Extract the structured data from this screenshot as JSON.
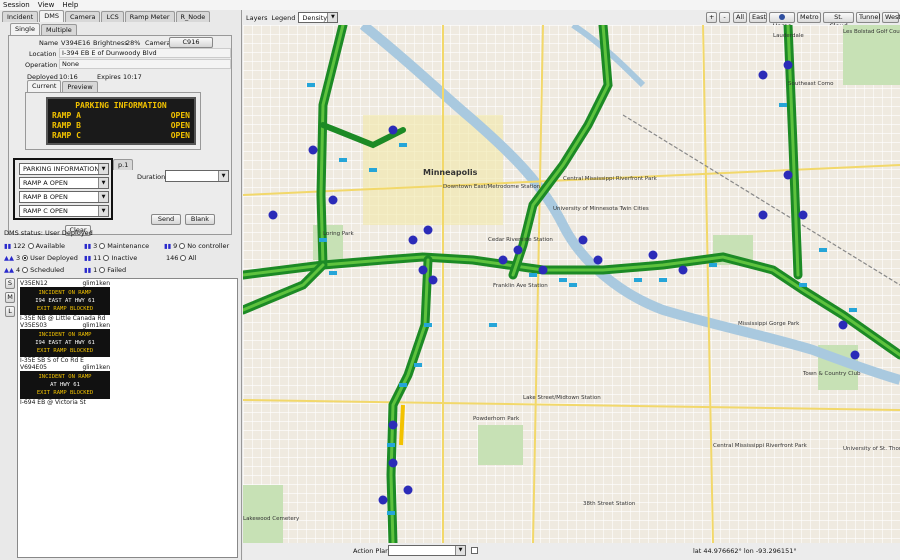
{
  "menu": [
    "Session",
    "View",
    "Help"
  ],
  "main_tabs": [
    "Incident",
    "DMS",
    "Camera",
    "LCS",
    "Ramp Meter",
    "R_Node"
  ],
  "sub_tabs": [
    "Single",
    "Multiple"
  ],
  "dms": {
    "name_label": "Name",
    "name": "V394E16",
    "brightness_label": "Brightness",
    "brightness": "28%",
    "camera_label": "Camera",
    "camera": "C916",
    "location_label": "Location",
    "location": "I-394 EB E of Dunwoody Blvd",
    "operation_label": "Operation",
    "operation": "None",
    "deployed_label": "Deployed",
    "deployed": "10:16",
    "expires_label": "Expires",
    "expires": "10:17"
  },
  "preview_tabs": [
    "Current",
    "Preview"
  ],
  "sign_lines": [
    {
      "left": "PARKING INFORMATION",
      "right": ""
    },
    {
      "left": "RAMP A",
      "right": "OPEN"
    },
    {
      "left": "RAMP B",
      "right": "OPEN"
    },
    {
      "left": "RAMP C",
      "right": "OPEN"
    }
  ],
  "compose": {
    "line1": "PARKING INFORMATION",
    "line2": "RAMP A OPEN",
    "line3": "RAMP B OPEN",
    "line4": "RAMP C OPEN",
    "page_label": "p.1",
    "duration_label": "Duration",
    "duration": "",
    "send": "Send",
    "blank": "Blank",
    "clear": "Clear"
  },
  "status": {
    "title": "DMS status: User Deployed",
    "items": [
      {
        "sym": "▮▮",
        "count": "122",
        "label": "Available",
        "selected": false
      },
      {
        "sym": "▮▮",
        "count": "3",
        "label": "Maintenance",
        "selected": false
      },
      {
        "sym": "▮▮",
        "count": "9",
        "label": "No controller",
        "selected": false
      },
      {
        "sym": "▲▲",
        "count": "3",
        "label": "User Deployed",
        "selected": true
      },
      {
        "sym": "▮▮",
        "count": "11",
        "label": "Inactive",
        "selected": false
      },
      {
        "sym": "",
        "count": "146",
        "label": "All",
        "selected": false
      },
      {
        "sym": "▲▲",
        "count": "4",
        "label": "Scheduled",
        "selected": false
      },
      {
        "sym": "▮▮",
        "count": "1",
        "label": "Failed",
        "selected": false
      }
    ]
  },
  "size_buttons": [
    "S",
    "M",
    "L"
  ],
  "cards": [
    {
      "id": "V35EN12",
      "user": "glim1ken",
      "lines": [
        "INCIDENT ON RAMP",
        "I94 EAST AT HWY 61",
        "EXIT RAMP BLOCKED"
      ],
      "location": "I-35E NB @ Little Canada Rd"
    },
    {
      "id": "V35ES03",
      "user": "glim1ken",
      "lines": [
        "INCIDENT ON RAMP",
        "I94 EAST AT HWY 61",
        "EXIT RAMP BLOCKED"
      ],
      "location": "I-35E SB S of Co Rd E"
    },
    {
      "id": "V694E05",
      "user": "glim1ken",
      "lines": [
        "INCIDENT ON RAMP",
        "AT HWY 61",
        "EXIT RAMP BLOCKED"
      ],
      "location": "I-694 EB @ Victoria St"
    }
  ],
  "map_toolbar": {
    "layers": "Layers",
    "legend": "Legend",
    "legend_value": "Density",
    "zoom_in": "+",
    "zoom_out": "-",
    "buttons": [
      "All",
      "East",
      "Home",
      "Metro",
      "St. Cloud",
      "Tunnel",
      "West"
    ]
  },
  "map_labels": [
    {
      "text": "Minneapolis",
      "bold": true
    },
    {
      "text": "Downtown East/Metrodome Station",
      "bold": false
    },
    {
      "text": "Central Mississippi Riverfront Park",
      "bold": false
    },
    {
      "text": "University of Minnesota Twin Cities",
      "bold": false
    },
    {
      "text": "Loring Park",
      "bold": false
    },
    {
      "text": "Cedar Riverside Station",
      "bold": false
    },
    {
      "text": "Lauderdale",
      "bold": false
    },
    {
      "text": "Les Bolstad Golf Course",
      "bold": false
    },
    {
      "text": "Southeast Como",
      "bold": false
    },
    {
      "text": "Mississippi Gorge Park",
      "bold": false
    },
    {
      "text": "Town & Country Club",
      "bold": false
    },
    {
      "text": "Powderhorn Park",
      "bold": false
    },
    {
      "text": "Lake Street/Midtown Station",
      "bold": false
    },
    {
      "text": "38th Street Station",
      "bold": false
    },
    {
      "text": "Lakewood Cemetery",
      "bold": false
    },
    {
      "text": "University of St. Thomas",
      "bold": false
    },
    {
      "text": "Franklin Ave Station",
      "bold": false
    },
    {
      "text": "Central Mississippi Riverfront Park",
      "bold": false
    }
  ],
  "bottom": {
    "action_plan_label": "Action Plan",
    "action_plan": "",
    "coords": "lat 44.976662° lon -93.296151°"
  },
  "colors": {
    "freeway": "#1c8a25",
    "freeway_inner": "#5ec23e",
    "dms_marker": "#2b2bb8",
    "detector": "#25a5d8",
    "water": "#a9c9df",
    "park": "#c7e1b5"
  }
}
